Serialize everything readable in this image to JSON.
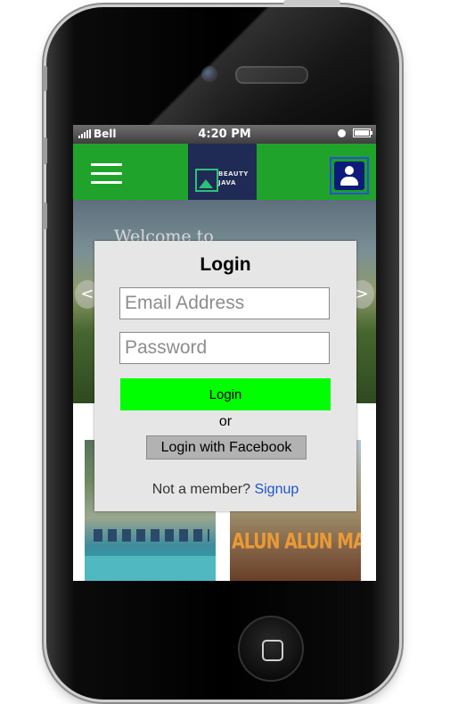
{
  "status_bar": {
    "carrier": "Bell",
    "time": "4:20 PM"
  },
  "navbar": {
    "logo_line1": "BEAUTY",
    "logo_line2": "JAVA",
    "accent_color": "#1fa32a"
  },
  "hero": {
    "welcome_text": "Welcome to",
    "prev_glyph": "<",
    "next_glyph": ">"
  },
  "cards": [
    {
      "sign_text": ""
    },
    {
      "sign_text": "ALUN ALUN MALANG"
    }
  ],
  "login_modal": {
    "title": "Login",
    "email_placeholder": "Email Address",
    "password_placeholder": "Password",
    "login_button": "Login",
    "or_text": "or",
    "facebook_button": "Login with Facebook",
    "member_prompt": "Not a member?",
    "signup_link": "Signup",
    "login_button_color": "#00ff00"
  },
  "icons": [
    "hamburger-menu-icon",
    "user-icon",
    "signal-icon",
    "battery-icon",
    "home-button-icon"
  ]
}
